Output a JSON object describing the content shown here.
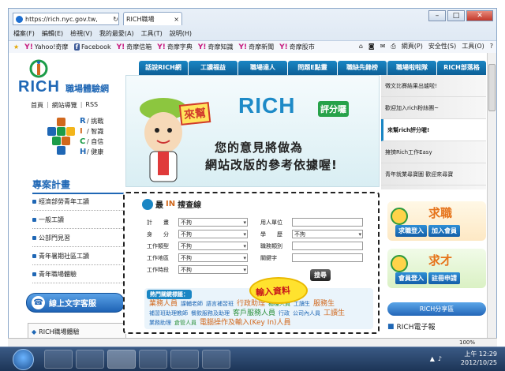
{
  "browser": {
    "url": "https://rich.nyc.gov.tw,",
    "tab_title": "RICH職場",
    "menu": [
      "檔案(F)",
      "編輯(E)",
      "檢視(V)",
      "我的最愛(A)",
      "工具(T)",
      "說明(H)"
    ],
    "favorites": [
      "Yahoo!奇摩",
      "Facebook",
      "奇摩信箱",
      "奇摩字典",
      "奇摩知識",
      "奇摩新聞",
      "奇摩股市"
    ],
    "commands": [
      "網頁(P)",
      "安全性(S)",
      "工具(O)"
    ],
    "zoom": "100%"
  },
  "site": {
    "logo_text": "RICH",
    "logo_sub": "職場體驗網",
    "top_links": [
      "首頁",
      "網站導覽",
      "RSS"
    ],
    "values": [
      {
        "letter": "R",
        "text": "/ 挑戰"
      },
      {
        "letter": "I",
        "text": "/ 智識"
      },
      {
        "letter": "C",
        "text": "/ 自信"
      },
      {
        "letter": "H",
        "text": "/ 健康"
      }
    ],
    "nav": [
      "話說RICH網",
      "工讀福益",
      "職場達人",
      "問題E點靈",
      "職缺先鋒榜",
      "職場啦啦隊",
      "RICH部落格"
    ],
    "projects_title": "專案計畫",
    "projects": [
      "經濟部勞青年工讀",
      "一般工讀",
      "公部門見習",
      "青年暑期社區工讀",
      "青年職場體驗"
    ],
    "chat_button": "線上文字客服",
    "bottom_left": "RICH職場體驗"
  },
  "banner": {
    "sign_left": "來幫",
    "rich": "RICH",
    "sign_right": "評分囉",
    "line1": "您的意見將做為",
    "line2": "網站改版的參考依據喔!"
  },
  "right_menu": [
    "徵文比賽結果出爐啦!",
    "歡迎加入rich粉絲團~",
    "來幫rich評分喔!",
    "擁擠Rich工作Easy",
    "青年就業尋寶圖 歡迎來尋寶"
  ],
  "search": {
    "title_prefix": "最",
    "title_in": "IN",
    "title_suffix": "搜查線",
    "left_fields": [
      {
        "label": "計　　畫",
        "value": "不拘"
      },
      {
        "label": "身　　分",
        "value": "不拘"
      },
      {
        "label": "工作類型",
        "value": "不拘"
      },
      {
        "label": "工作地區",
        "value": "不拘"
      },
      {
        "label": "工作時段",
        "value": "不拘"
      }
    ],
    "right_fields": [
      {
        "label": "用人單位",
        "value": ""
      },
      {
        "label": "學　　歷",
        "value": "不拘"
      },
      {
        "label": "職務類別",
        "value": ""
      },
      {
        "label": "關鍵字",
        "value": ""
      }
    ],
    "button": "搜尋",
    "note": "輸入資料",
    "hot_title": "熱門關鍵標籤：",
    "hot_tags": [
      "業務人員",
      "課輔老師",
      "語言補習班",
      "行政助理",
      "櫃檯人員",
      "工讀生",
      "服務生",
      "補習班助理教師",
      "餐飲服務及助理",
      "客戶服務人員",
      "行政",
      "公司內人員",
      "工讀生",
      "業務助理",
      "倉管人員",
      "電腦操作及輸入(Key In)人員"
    ]
  },
  "side": {
    "job_big": "求職",
    "job_btns": [
      "求職登入",
      "加入會員"
    ],
    "talent_big": "求才",
    "talent_btns": [
      "會員登入",
      "註冊申請"
    ],
    "share": "RICH分享區",
    "elec": "RICH電子報"
  },
  "taskbar": {
    "time": "上午 12:29",
    "date": "2012/10/25"
  }
}
